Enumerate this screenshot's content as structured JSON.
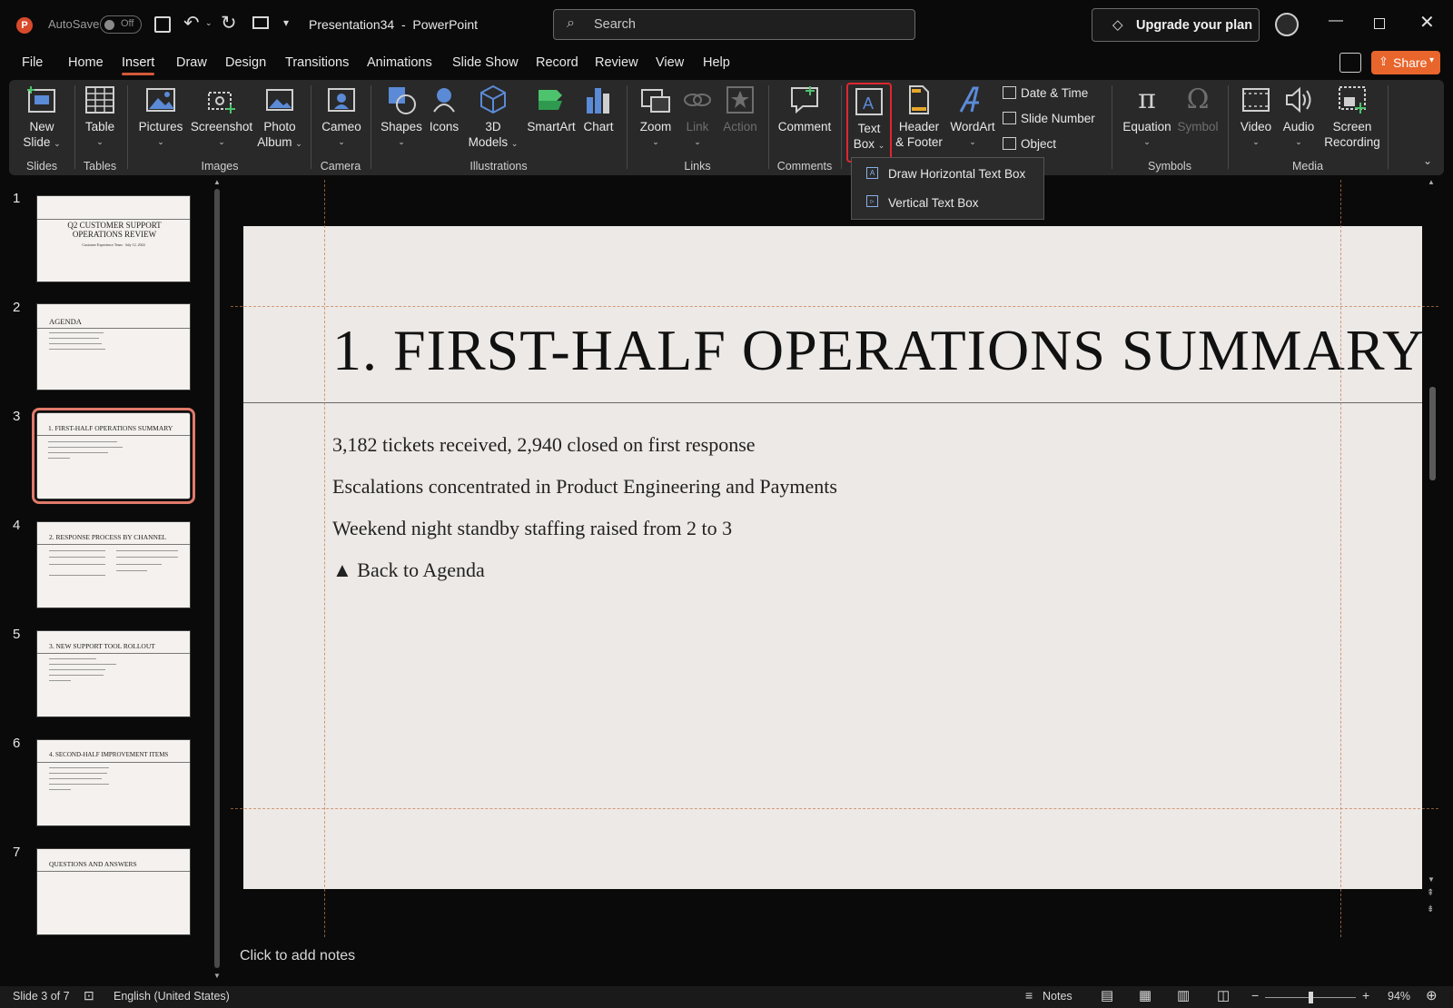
{
  "titlebar": {
    "autosave_label": "AutoSave",
    "autosave_state": "Off",
    "document_title": "Presentation34  -  PowerPoint",
    "search_placeholder": "Search",
    "upgrade_label": "Upgrade your plan"
  },
  "menu": {
    "tabs": [
      "File",
      "Home",
      "Insert",
      "Draw",
      "Design",
      "Transitions",
      "Animations",
      "Slide Show",
      "Record",
      "Review",
      "View",
      "Help"
    ],
    "active": "Insert",
    "share_label": "Share"
  },
  "ribbon": {
    "new_slide": [
      "New",
      "Slide"
    ],
    "table": "Table",
    "pictures": "Pictures",
    "screenshot": "Screenshot",
    "photo_album": [
      "Photo",
      "Album"
    ],
    "cameo": "Cameo",
    "shapes": "Shapes",
    "icons": "Icons",
    "models_3d": [
      "3D",
      "Models"
    ],
    "smartart": "SmartArt",
    "chart": "Chart",
    "zoom": "Zoom",
    "link": "Link",
    "action": "Action",
    "comment": "Comment",
    "text_box": [
      "Text",
      "Box"
    ],
    "header_footer": [
      "Header",
      "& Footer"
    ],
    "wordart": "WordArt",
    "date_time": "Date & Time",
    "slide_number": "Slide Number",
    "object": "Object",
    "equation": "Equation",
    "symbol": "Symbol",
    "video": "Video",
    "audio": "Audio",
    "screen_recording": [
      "Screen",
      "Recording"
    ],
    "groups": {
      "slides": "Slides",
      "tables": "Tables",
      "images": "Images",
      "camera": "Camera",
      "illustrations": "Illustrations",
      "links": "Links",
      "comments": "Comments",
      "symbols": "Symbols",
      "media": "Media"
    }
  },
  "textbox_dropdown": {
    "items": [
      "Draw Horizontal Text Box",
      "Vertical Text Box"
    ]
  },
  "thumbnails": [
    {
      "num": "1",
      "title": "Q2 CUSTOMER SUPPORT OPERATIONS REVIEW",
      "subtitle": "Customer Experience Team · July 12, 2024"
    },
    {
      "num": "2",
      "title": "AGENDA"
    },
    {
      "num": "3",
      "title": "1. FIRST-HALF OPERATIONS SUMMARY"
    },
    {
      "num": "4",
      "title": "2. RESPONSE PROCESS BY CHANNEL"
    },
    {
      "num": "5",
      "title": "3. NEW SUPPORT TOOL ROLLOUT"
    },
    {
      "num": "6",
      "title": "4. SECOND-HALF IMPROVEMENT ITEMS"
    },
    {
      "num": "7",
      "title": "QUESTIONS AND ANSWERS"
    }
  ],
  "slide": {
    "title": "1. FIRST-HALF OPERATIONS SUMMARY",
    "bullets": [
      "3,182 tickets received, 2,940 closed on first response",
      "Escalations concentrated in Product Engineering and Payments",
      "Weekend night standby staffing raised from 2 to 3",
      "▲ Back to Agenda"
    ]
  },
  "notes_placeholder": "Click to add notes",
  "status": {
    "slide_info": "Slide 3 of 7",
    "language": "English (United States)",
    "notes_label": "Notes",
    "zoom": "94%"
  },
  "colors": {
    "accent": "#d2593a",
    "share_bg": "#e8652b",
    "highlight_box": "#e0262f",
    "slide_bg": "#ede9e6"
  }
}
